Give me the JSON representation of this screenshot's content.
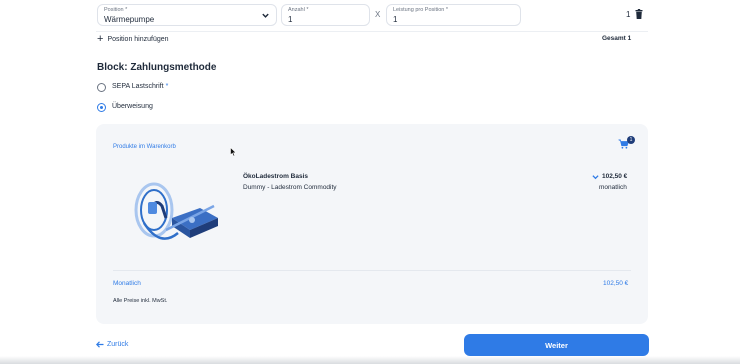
{
  "position_row": {
    "position_label": "Position *",
    "position_value": "Wärmepumpe",
    "anzahl_label": "Anzahl *",
    "anzahl_value": "1",
    "times_symbol": "X",
    "leistung_label": "Leistung pro Position *",
    "leistung_value": "1",
    "row_quantity": "1"
  },
  "add_position": {
    "plus": "+",
    "label": "Position hinzufügen"
  },
  "total_label": "Gesamt 1",
  "block": {
    "title": "Block: Zahlungsmethode",
    "options": [
      {
        "label": "SEPA Lastschrift",
        "required_mark": "*",
        "selected": false
      },
      {
        "label": "Überweisung",
        "selected": true
      }
    ]
  },
  "cart": {
    "header": "Produkte im Warenkorb",
    "badge_count": "1",
    "product": {
      "name": "ÖkoLadestrom Basis",
      "description": "Dummy - Ladestrom Commodity",
      "price": "102,50 €",
      "frequency": "monatlich"
    },
    "monthly_label": "Monatlich",
    "monthly_value": "102,50 €",
    "vat_note": "Alle Preise inkl. MwSt."
  },
  "nav": {
    "back_label": "Zurück",
    "next_label": "Weiter"
  },
  "colors": {
    "accent": "#2f7be6",
    "panel_bg": "#f4f6f9",
    "text": "#1f2a3a"
  }
}
